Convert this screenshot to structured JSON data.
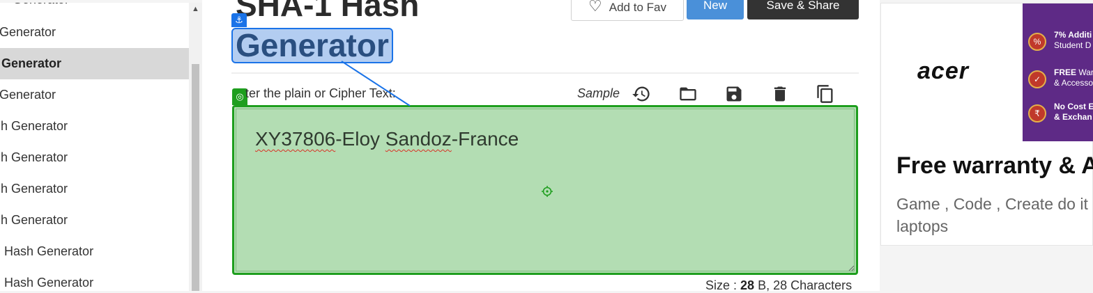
{
  "sidebar": {
    "items": [
      {
        "label": "Generator"
      },
      {
        "label": "Generator"
      },
      {
        "label": "Generator"
      },
      {
        "label": "Generator"
      },
      {
        "label": "h Generator"
      },
      {
        "label": "h Generator"
      },
      {
        "label": "h Generator"
      },
      {
        "label": "h Generator"
      },
      {
        "label": "Hash Generator"
      },
      {
        "label": "Hash Generator"
      }
    ],
    "active_index": 2,
    "scroll_up_icon": "triangle-up"
  },
  "header": {
    "title_line1": "SHA-1 Hash",
    "title_line2": "Generator",
    "add_to_fav_label": "Add to Fav",
    "new_label": "New",
    "save_share_label": "Save & Share"
  },
  "input": {
    "label": "ter the plain or Cipher Text:",
    "sample_label": "Sample",
    "text_part1": "XY37806",
    "text_part2": "-Eloy ",
    "text_part3": "Sandoz",
    "text_part4": "-France",
    "icons": [
      "history-icon",
      "folder-open-icon",
      "save-icon",
      "delete-icon",
      "copy-icon"
    ]
  },
  "size": {
    "prefix": "Size : ",
    "bytes": "28",
    "suffix": " B, 28 Characters"
  },
  "ad": {
    "brand": "acer",
    "perks": [
      {
        "bold": "7% Additi",
        "rest": "Student D"
      },
      {
        "bold": "FREE",
        "rest_line1": " War",
        "rest": "& Accesso"
      },
      {
        "bold": "No Cost E",
        "rest": "& Exchan"
      }
    ],
    "headline": "Free warranty & A",
    "description": "Game , Code , Create do it laptops"
  },
  "colors": {
    "selection": "#b3cdf1",
    "selection_border": "#1a73e8",
    "textarea_bg": "#b3ddb3",
    "textarea_border": "#1e9e1e",
    "ad_purple": "#5e2a86"
  }
}
